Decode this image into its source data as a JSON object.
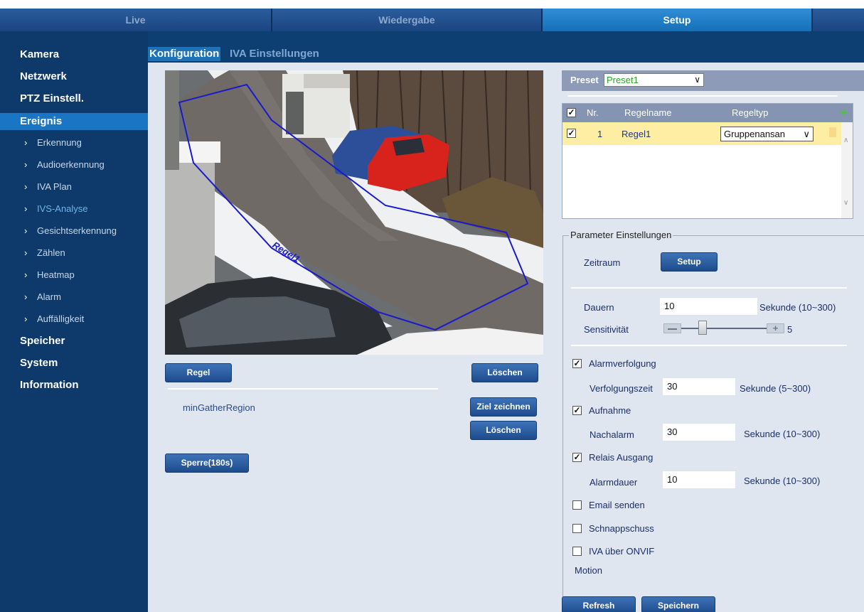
{
  "topnav": {
    "tabs": [
      "Live",
      "Wiedergabe",
      "Setup"
    ],
    "active": "Setup"
  },
  "sidebar": {
    "items": [
      {
        "label": "Kamera",
        "type": "main"
      },
      {
        "label": "Netzwerk",
        "type": "main"
      },
      {
        "label": "PTZ Einstell.",
        "type": "main"
      },
      {
        "label": "Ereignis",
        "type": "main",
        "active": true
      },
      {
        "label": "Erkennung",
        "type": "sub"
      },
      {
        "label": "Audioerkennung",
        "type": "sub"
      },
      {
        "label": "IVA Plan",
        "type": "sub"
      },
      {
        "label": "IVS-Analyse",
        "type": "sub",
        "active": true
      },
      {
        "label": "Gesichtserkennung",
        "type": "sub"
      },
      {
        "label": "Zählen",
        "type": "sub"
      },
      {
        "label": "Heatmap",
        "type": "sub"
      },
      {
        "label": "Alarm",
        "type": "sub"
      },
      {
        "label": "Auffälligkeit",
        "type": "sub"
      },
      {
        "label": "Speicher",
        "type": "main"
      },
      {
        "label": "System",
        "type": "main"
      },
      {
        "label": "Information",
        "type": "main"
      }
    ]
  },
  "subtabs": {
    "config": "Konfiguration",
    "iva": "IVA Einstellungen"
  },
  "video": {
    "rule_overlay_label": "Regel1",
    "region_color": "#1a1acc"
  },
  "left_panel": {
    "regel_button": "Regel",
    "loeschen1_button": "Löschen",
    "region_label": "minGatherRegion",
    "ziel_button": "Ziel zeichnen",
    "loeschen2_button": "Löschen",
    "sperre_button": "Sperre(180s)"
  },
  "preset": {
    "label": "Preset",
    "value": "Preset1"
  },
  "rules_table": {
    "headers": {
      "nr": "Nr.",
      "name": "Regelname",
      "type": "Regeltyp"
    },
    "rows": [
      {
        "checked": true,
        "nr": "1",
        "name": "Regel1",
        "type": "Gruppenansan"
      }
    ]
  },
  "params": {
    "legend": "Parameter Einstellungen",
    "zeitraum_label": "Zeitraum",
    "setup_button": "Setup",
    "dauern_label": "Dauern",
    "dauern_value": "10",
    "dauern_unit": "Sekunde (10~300)",
    "sens_label": "Sensitivität",
    "sens_value": "5",
    "sens_max": 10,
    "alarmverfolgung_label": "Alarmverfolgung",
    "alarmverfolgung_checked": true,
    "verfolgungszeit_label": "Verfolgungszeit",
    "verfolgungszeit_value": "30",
    "verfolgungszeit_unit": "Sekunde (5~300)",
    "aufnahme_label": "Aufnahme",
    "aufnahme_checked": true,
    "nachalarm_label": "Nachalarm",
    "nachalarm_value": "30",
    "nachalarm_unit": "Sekunde (10~300)",
    "relais_label": "Relais Ausgang",
    "relais_checked": true,
    "alarmdauer_label": "Alarmdauer",
    "alarmdauer_value": "10",
    "alarmdauer_unit": "Sekunde (10~300)",
    "email_label": "Email senden",
    "email_checked": false,
    "snap_label": "Schnappschuss",
    "snap_checked": false,
    "onvif_label": "IVA über ONVIF",
    "onvif_checked": false,
    "motion_label": "Motion"
  },
  "footer": {
    "refresh": "Refresh",
    "save": "Speichern"
  }
}
